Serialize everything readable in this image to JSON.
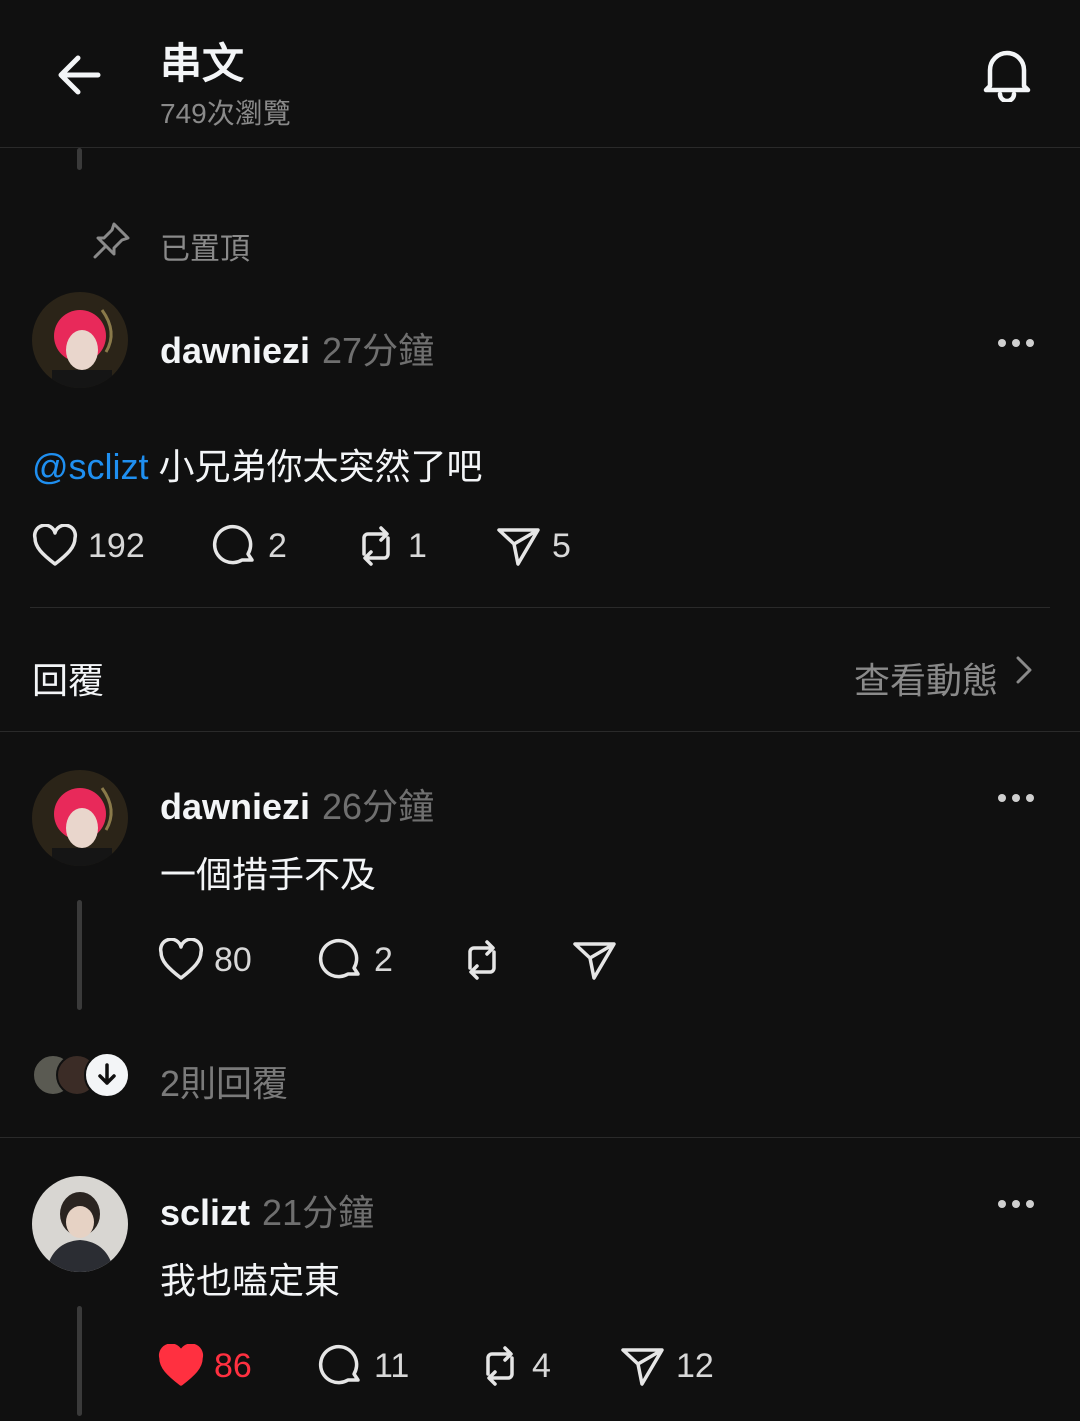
{
  "header": {
    "title": "串文",
    "views": "749次瀏覽"
  },
  "pinned_label": "已置頂",
  "main_post": {
    "username": "dawniezi",
    "time": "27分鐘",
    "mention": "@sclizt",
    "text": " 小兄弟你太突然了吧",
    "likes": "192",
    "comments": "2",
    "reposts": "1",
    "shares": "5"
  },
  "section": {
    "replies_label": "回覆",
    "view_activity": "查看動態"
  },
  "reply1": {
    "username": "dawniezi",
    "time": "26分鐘",
    "text": "一個措手不及",
    "likes": "80",
    "comments": "2",
    "more_replies": "2則回覆"
  },
  "reply2": {
    "username": "sclizt",
    "time": "21分鐘",
    "text": "我也嗑定東",
    "likes": "86",
    "liked": true,
    "comments": "11",
    "reposts": "4",
    "shares": "12"
  },
  "colors": {
    "background": "#101010",
    "mention": "#1f8ff0",
    "liked": "#ff3040"
  }
}
